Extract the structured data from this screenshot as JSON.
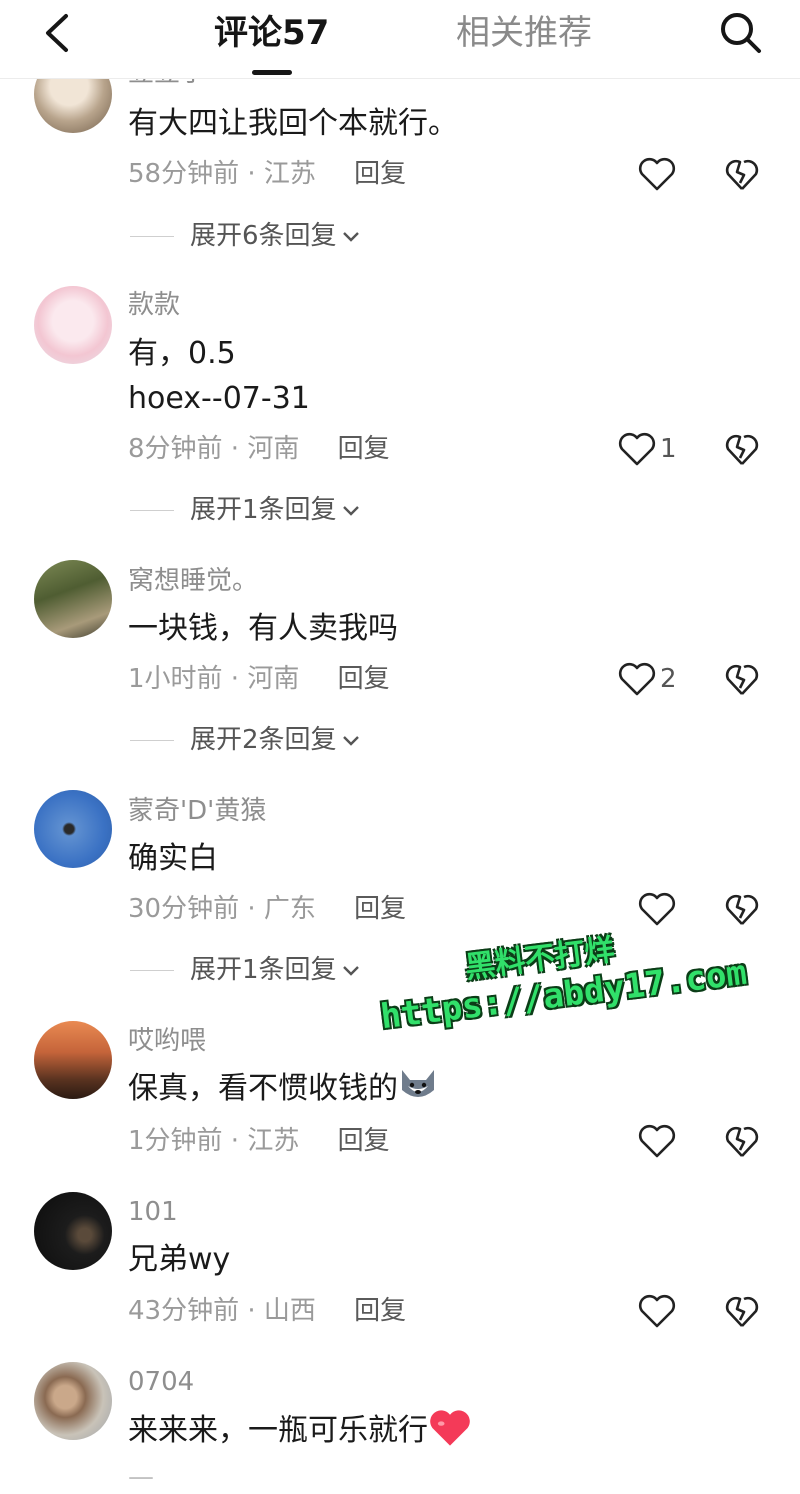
{
  "header": {
    "active_tab": "评论57",
    "other_tab": "相关推荐"
  },
  "comments": [
    {
      "username": "豆豆子",
      "lines": [
        "有大四让我回个本就行。"
      ],
      "time": "58分钟前",
      "location": "江苏",
      "reply": "回复",
      "likes": "",
      "expand": "展开6条回复"
    },
    {
      "username": "款款",
      "lines": [
        "有，0.5",
        "hoex--07-31"
      ],
      "time": "8分钟前",
      "location": "河南",
      "reply": "回复",
      "likes": "1",
      "expand": "展开1条回复"
    },
    {
      "username": "窝想睡觉。",
      "lines": [
        "一块钱，有人卖我吗"
      ],
      "time": "1小时前",
      "location": "河南",
      "reply": "回复",
      "likes": "2",
      "expand": "展开2条回复"
    },
    {
      "username": "蒙奇'D'黄猿",
      "lines": [
        "确实白"
      ],
      "time": "30分钟前",
      "location": "广东",
      "reply": "回复",
      "likes": "",
      "expand": "展开1条回复"
    },
    {
      "username": "哎哟喂",
      "lines": [
        "保真，看不惯收钱的"
      ],
      "time": "1分钟前",
      "location": "江苏",
      "reply": "回复",
      "likes": "",
      "expand": ""
    },
    {
      "username": "101",
      "lines": [
        "兄弟wy"
      ],
      "time": "43分钟前",
      "location": "山西",
      "reply": "回复",
      "likes": "",
      "expand": ""
    },
    {
      "username": "0704",
      "lines": [
        "来来来，一瓶可乐就行"
      ],
      "time": "",
      "location": "",
      "reply": "",
      "likes": "",
      "expand": ""
    }
  ],
  "watermark": {
    "line1": "黑料不打烊",
    "line2": "https://abdy17.com"
  },
  "colors": {
    "watermark_green": "#31e06a",
    "heart_red": "#f43a58",
    "tab_inactive": "#8a8a8a"
  },
  "icons": [
    "back-arrow-icon",
    "search-icon",
    "heart-outline-icon",
    "broken-heart-icon",
    "chevron-down-icon",
    "husky-emoji-icon",
    "red-heart-emoji-icon"
  ]
}
